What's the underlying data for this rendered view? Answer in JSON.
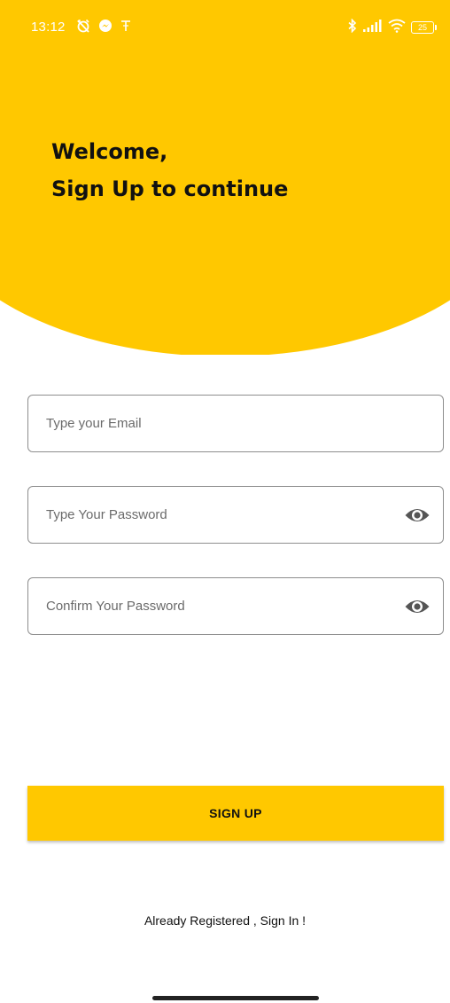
{
  "status_bar": {
    "time": "13:12",
    "battery": "25",
    "left_icons": [
      "alarm-off-icon",
      "messenger-icon",
      "t-icon"
    ],
    "right_icons": [
      "bluetooth-icon",
      "signal-icon",
      "wifi-icon",
      "battery-icon"
    ]
  },
  "header": {
    "line1": "Welcome,",
    "line2": "Sign Up to continue",
    "color": "#FFC800"
  },
  "form": {
    "email_placeholder": "Type your Email",
    "password_placeholder": "Type Your Password",
    "confirm_placeholder": "Confirm Your Password",
    "eye_icon": "eye-icon"
  },
  "actions": {
    "signup_label": "SIGN UP",
    "signin_link": "Already Registered , Sign In !"
  },
  "colors": {
    "accent": "#FFC800",
    "border": "#8e8e8e",
    "text": "#111111"
  }
}
